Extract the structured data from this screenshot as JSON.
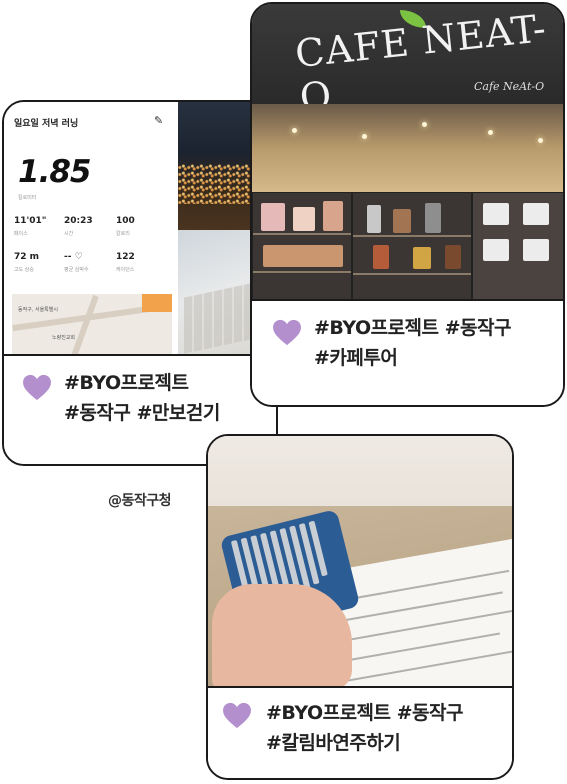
{
  "colors": {
    "heart": "#b48fcd",
    "border": "#1a1a1a"
  },
  "running_card": {
    "app": {
      "title": "일요일 저녁 러닝",
      "distance": "1.85",
      "distance_unit": "킬로미터",
      "stats_row1": [
        {
          "value": "11'01\"",
          "label": "페이스"
        },
        {
          "value": "20:23",
          "label": "시간"
        },
        {
          "value": "100",
          "label": "칼로리"
        }
      ],
      "stats_row2": [
        {
          "value": "72 m",
          "label": "고도 상승"
        },
        {
          "value": "-- ♡",
          "label": "평균 심박수"
        },
        {
          "value": "122",
          "label": "케이던스"
        }
      ],
      "map_labels": [
        "동작구, 서울특별시",
        "노량진교회"
      ]
    },
    "caption_line1": "#BYO프로젝트",
    "caption_line2": "#동작구 #만보걷기"
  },
  "cafe_card": {
    "sign_text": "CAFE NEAT-O",
    "sign_small": "Cafe NeAt-O",
    "caption_line1": "#BYO프로젝트 #동작구",
    "caption_line2": "#카페투어"
  },
  "kalimba_card": {
    "caption_line1": "#BYO프로젝트 #동작구",
    "caption_line2": "#칼림바연주하기"
  },
  "handle": "@동작구청"
}
